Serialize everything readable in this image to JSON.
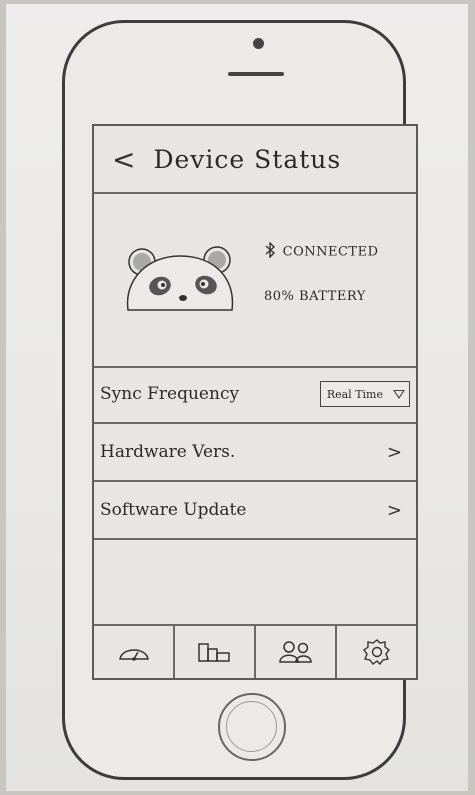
{
  "header": {
    "back_label": "<",
    "title": "Device Status"
  },
  "device": {
    "connection_status": "CONNECTED",
    "battery_status": "80% BATTERY",
    "avatar_icon": "panda-icon",
    "bluetooth_icon": "bluetooth-icon"
  },
  "settings": {
    "rows": [
      {
        "label": "Sync Frequency",
        "type": "select",
        "value": "Real Time",
        "icon": "chevron-down-icon"
      },
      {
        "label": "Hardware Vers.",
        "type": "link",
        "chevron": ">"
      },
      {
        "label": "Software Update",
        "type": "link",
        "chevron": ">"
      }
    ]
  },
  "bottom_nav": {
    "items": [
      {
        "icon": "gauge-icon"
      },
      {
        "icon": "bar-chart-icon"
      },
      {
        "icon": "people-icon"
      },
      {
        "icon": "gear-icon"
      }
    ]
  },
  "colors": {
    "ink": "#2b2b2b",
    "paper": "#eceae7",
    "background": "#c9c6c1"
  }
}
